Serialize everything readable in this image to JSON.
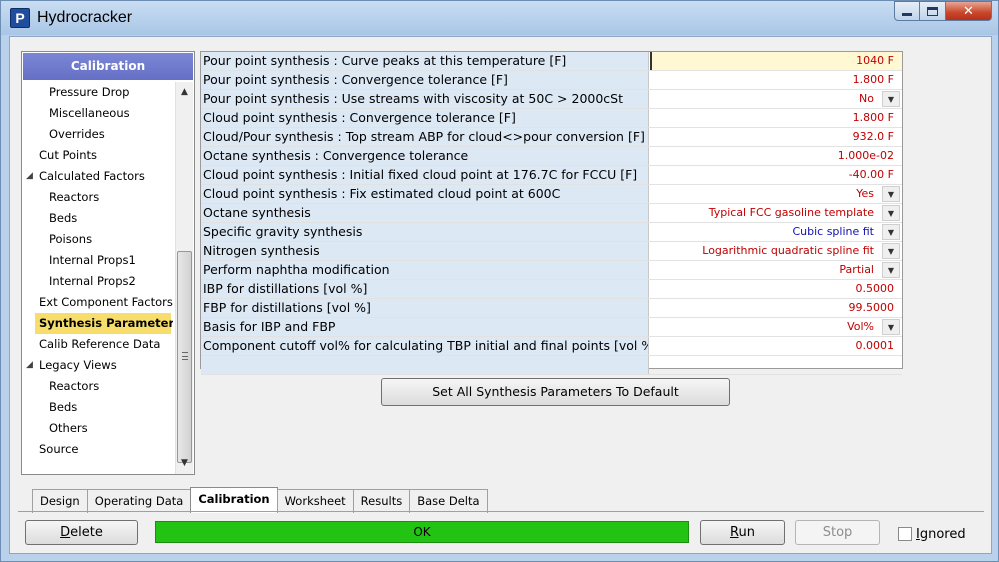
{
  "window": {
    "title": "Hydrocracker",
    "app_icon_letter": "P"
  },
  "nav": {
    "header": "Calibration",
    "items": [
      {
        "label": "Pressure Drop",
        "level": 2
      },
      {
        "label": "Miscellaneous",
        "level": 2
      },
      {
        "label": "Overrides",
        "level": 2
      },
      {
        "label": "Cut Points",
        "level": 1
      },
      {
        "label": "Calculated Factors",
        "level": 1,
        "expanded": true
      },
      {
        "label": "Reactors",
        "level": 2
      },
      {
        "label": "Beds",
        "level": 2
      },
      {
        "label": "Poisons",
        "level": 2
      },
      {
        "label": "Internal Props1",
        "level": 2
      },
      {
        "label": "Internal Props2",
        "level": 2
      },
      {
        "label": "Ext Component Factors",
        "level": 1
      },
      {
        "label": "Synthesis Parameters",
        "level": 1,
        "selected": true
      },
      {
        "label": "Calib Reference Data",
        "level": 1
      },
      {
        "label": "Legacy Views",
        "level": 1,
        "expanded": true
      },
      {
        "label": "Reactors",
        "level": 2
      },
      {
        "label": "Beds",
        "level": 2
      },
      {
        "label": "Others",
        "level": 2
      },
      {
        "label": "Source",
        "level": 1
      }
    ]
  },
  "grid": {
    "rows": [
      {
        "label": "Pour point synthesis : Curve peaks at this temperature [F]",
        "value": "1040 F"
      },
      {
        "label": "Pour point synthesis : Convergence tolerance [F]",
        "value": "1.800 F"
      },
      {
        "label": "Pour point synthesis : Use streams with viscosity at 50C > 2000cSt",
        "value": "No"
      },
      {
        "label": "Cloud point synthesis : Convergence tolerance [F]",
        "value": "1.800 F"
      },
      {
        "label": "Cloud/Pour synthesis : Top stream ABP for cloud<>pour conversion [F]",
        "value": "932.0 F"
      },
      {
        "label": "Octane synthesis : Convergence tolerance",
        "value": "1.000e-02"
      },
      {
        "label": "Cloud point synthesis : Initial fixed cloud point at 176.7C for FCCU [F]",
        "value": "-40.00 F"
      },
      {
        "label": "Cloud point synthesis : Fix estimated cloud point at 600C",
        "value": "Yes"
      },
      {
        "label": "Octane synthesis",
        "value": "Typical FCC gasoline template"
      },
      {
        "label": "Specific gravity synthesis",
        "value": "Cubic spline fit"
      },
      {
        "label": "Nitrogen synthesis",
        "value": "Logarithmic quadratic spline fit"
      },
      {
        "label": "Perform naphtha modification",
        "value": "Partial"
      },
      {
        "label": "IBP for distillations [vol %]",
        "value": "0.5000"
      },
      {
        "label": "FBP for distillations [vol %]",
        "value": "99.5000"
      },
      {
        "label": "Basis for IBP and FBP",
        "value": "Vol%"
      },
      {
        "label": "Component cutoff vol% for calculating TBP initial and final points [vol %]",
        "value": "0.0001"
      },
      {
        "label": "",
        "value": ""
      }
    ]
  },
  "buttons": {
    "set_default": "Set All Synthesis Parameters To Default",
    "delete_first": "D",
    "delete_rest": "elete",
    "run_first": "R",
    "run_rest": "un",
    "stop": "Stop"
  },
  "tabs": [
    "Design",
    "Operating Data",
    "Calibration",
    "Worksheet",
    "Results",
    "Base Delta"
  ],
  "status": {
    "text": "OK",
    "color": "#22c313"
  },
  "ignored": {
    "first": "I",
    "rest": "gnored"
  }
}
